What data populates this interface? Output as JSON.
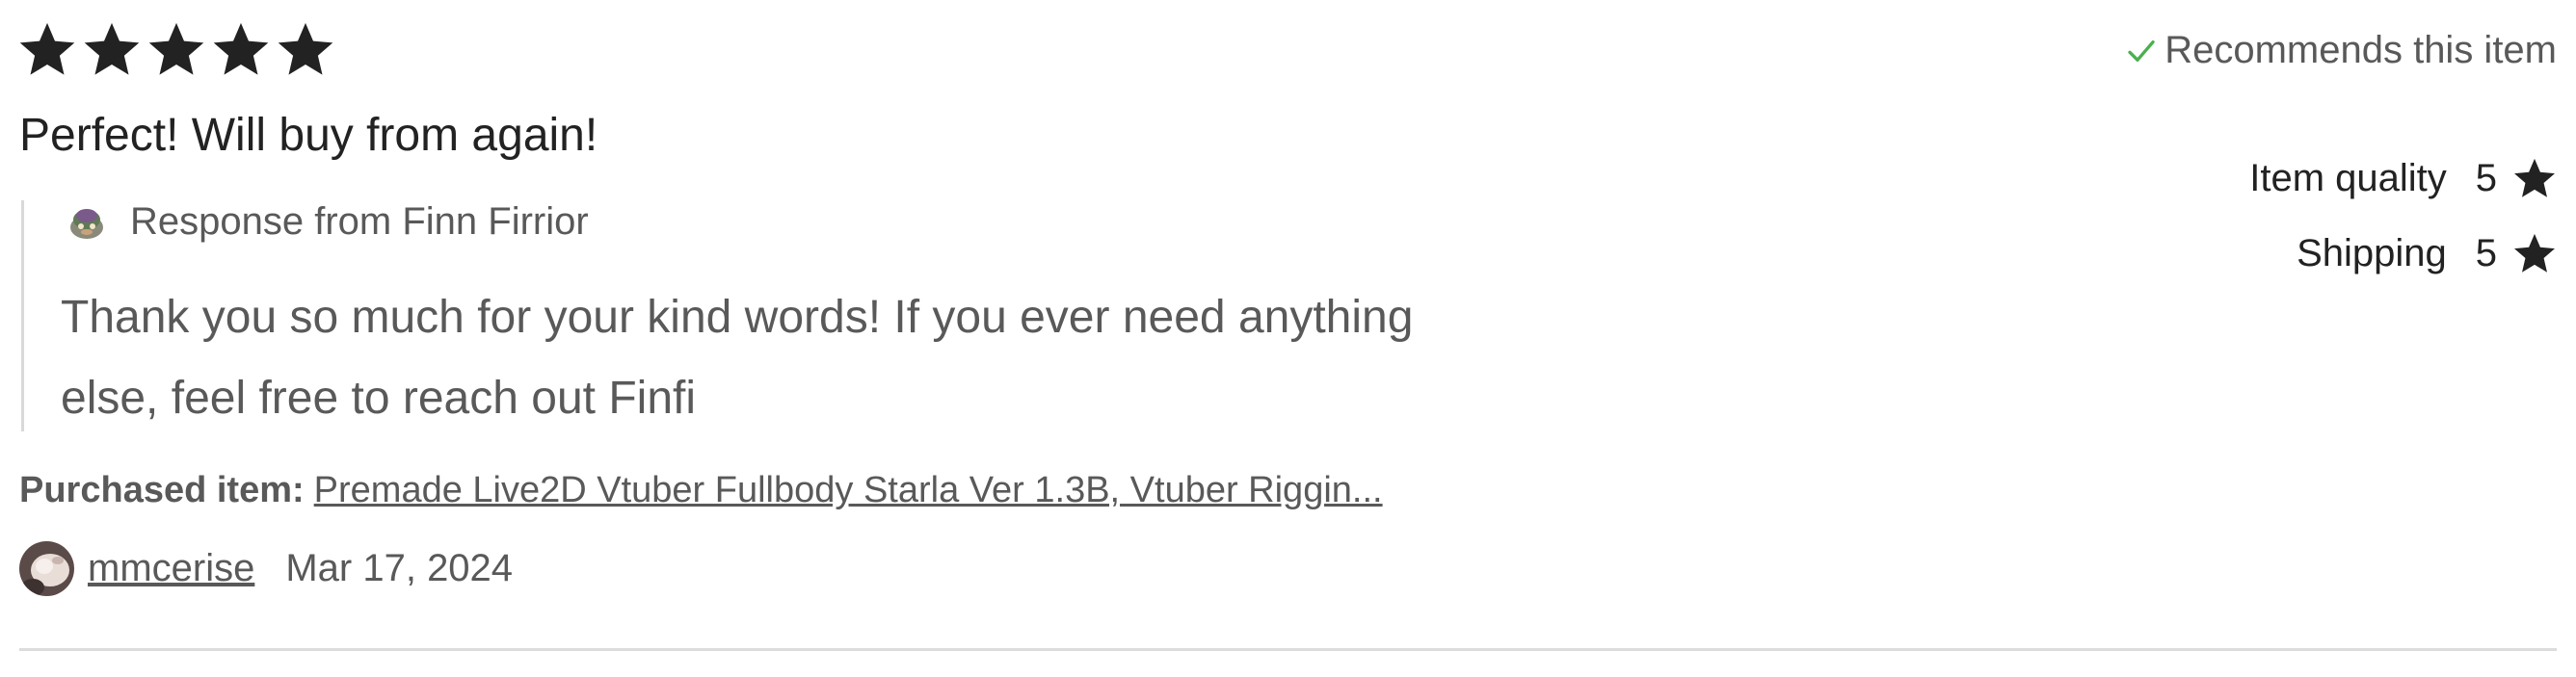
{
  "review": {
    "rating": 5,
    "rating_max": 5,
    "text": "Perfect! Will buy from again!",
    "recommends": "Recommends this item"
  },
  "response": {
    "title": "Response from Finn Firrior",
    "body": "Thank you so much for your kind words! If you ever need anything else, feel free to reach out Finfi"
  },
  "purchased": {
    "label": "Purchased item:",
    "item": "Premade Live2D Vtuber Fullbody Starla Ver 1.3B, Vtuber Riggin..."
  },
  "reviewer": {
    "username": "mmcerise",
    "date": "Mar 17, 2024"
  },
  "ratings": [
    {
      "label": "Item quality",
      "value": "5"
    },
    {
      "label": "Shipping",
      "value": "5"
    }
  ],
  "colors": {
    "text": "#222222",
    "muted": "#595959",
    "check": "#4caf50",
    "divider": "#dcdcdc"
  }
}
